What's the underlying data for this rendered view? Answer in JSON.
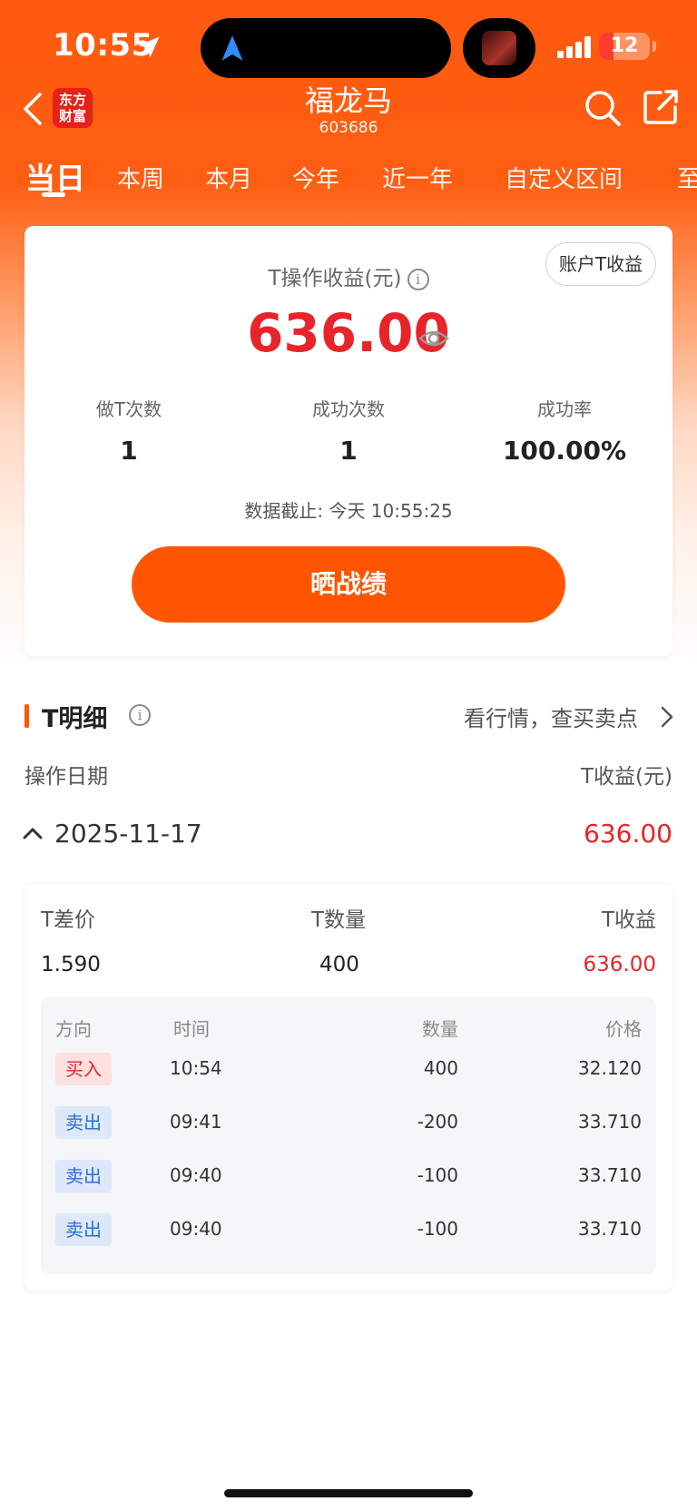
{
  "status": {
    "time": "10:55",
    "battery": "12"
  },
  "header": {
    "brand": "东方财富",
    "title": "福龙马",
    "code": "603686"
  },
  "tabs": [
    "当日",
    "本周",
    "本月",
    "今年",
    "近一年",
    "自定义区间",
    "至"
  ],
  "summary": {
    "account_button": "账户T收益",
    "profit_label": "T操作收益(元)",
    "profit_value": "636.00",
    "stats": [
      {
        "label": "做T次数",
        "value": "1"
      },
      {
        "label": "成功次数",
        "value": "1"
      },
      {
        "label": "成功率",
        "value": "100.00%"
      }
    ],
    "as_of": "数据截止: 今天 10:55:25",
    "share_button": "晒战绩"
  },
  "detail": {
    "section_title": "T明细",
    "section_link": "看行情，查买卖点",
    "col_date": "操作日期",
    "col_profit": "T收益(元)",
    "date": "2025-11-17",
    "date_profit": "636.00",
    "headers": [
      "T差价",
      "T数量",
      "T收益"
    ],
    "values": [
      "1.590",
      "400",
      "636.00"
    ],
    "trade_headers": [
      "方向",
      "时间",
      "数量",
      "价格"
    ],
    "trades": [
      {
        "direction": "买入",
        "type": "buy",
        "time": "10:54",
        "qty": "400",
        "price": "32.120"
      },
      {
        "direction": "卖出",
        "type": "sell",
        "time": "09:41",
        "qty": "-200",
        "price": "33.710"
      },
      {
        "direction": "卖出",
        "type": "sell",
        "time": "09:40",
        "qty": "-100",
        "price": "33.710"
      },
      {
        "direction": "卖出",
        "type": "sell",
        "time": "09:40",
        "qty": "-100",
        "price": "33.710"
      }
    ]
  },
  "colors": {
    "brand": "#ff5500",
    "profit": "#e8242b",
    "buy": "#e8242b",
    "sell": "#2a6fd1"
  }
}
